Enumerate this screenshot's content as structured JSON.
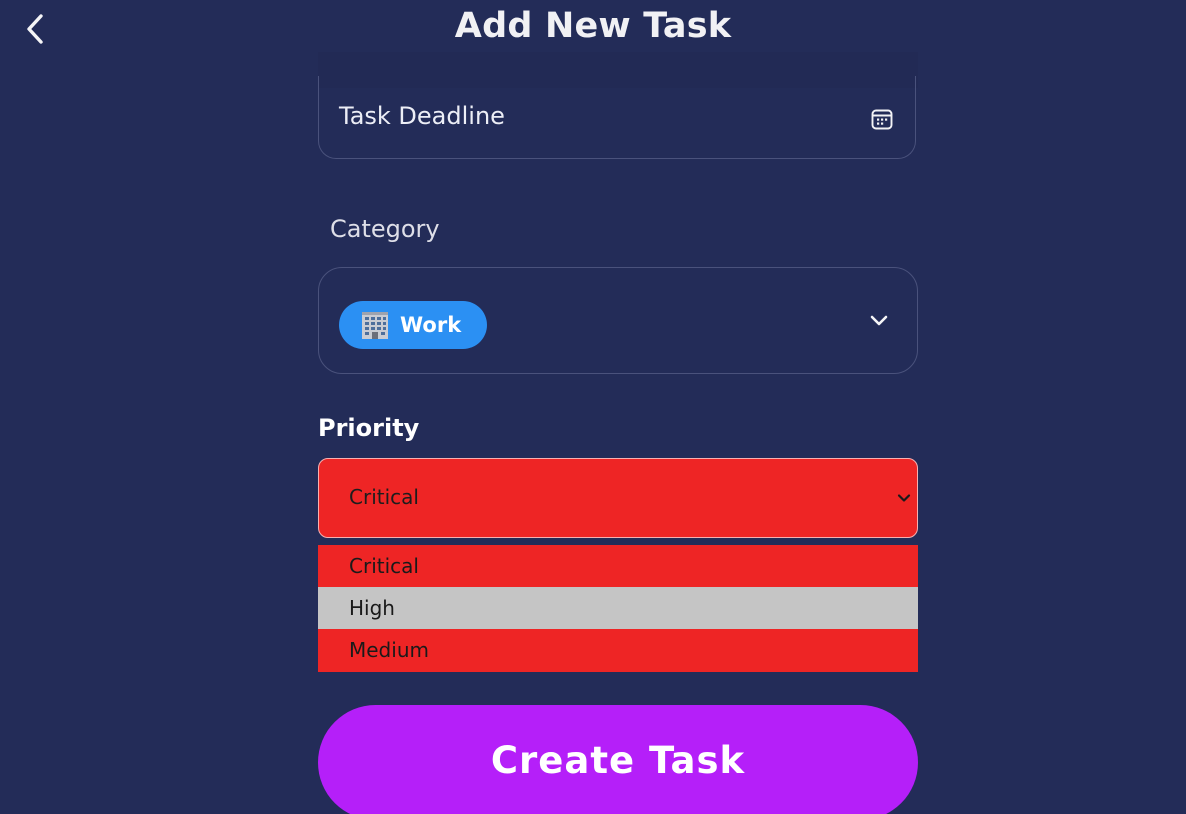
{
  "header": {
    "title": "Add New Task",
    "back_icon": "chevron-left-icon"
  },
  "deadline": {
    "placeholder": "Task Deadline",
    "icon": "calendar-icon"
  },
  "category": {
    "label": "Category",
    "selected": {
      "emoji": "office-building-icon",
      "name": "Work",
      "color": "#2b90f3"
    },
    "chevron_icon": "chevron-down-icon"
  },
  "priority": {
    "label": "Priority",
    "selected": "Critical",
    "color": "#ee2525",
    "options": [
      {
        "label": "Critical"
      },
      {
        "label": "High"
      },
      {
        "label": "Medium"
      }
    ],
    "hovered_option": "High"
  },
  "create_button": {
    "label": "Create Task",
    "color": "#b51ff9"
  },
  "theme": {
    "background": "#232c58",
    "text": "#ffffff"
  }
}
